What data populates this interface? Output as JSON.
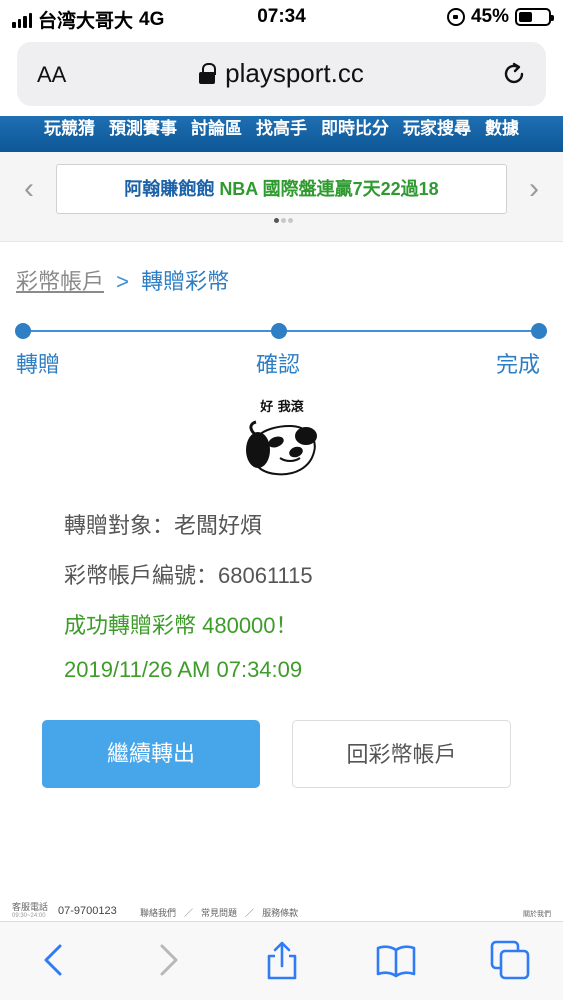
{
  "status_bar": {
    "carrier": "台湾大哥大",
    "network": "4G",
    "time": "07:34",
    "battery": "45%",
    "battery_level": 0.45
  },
  "browser": {
    "text_size_label": "AA",
    "url": "playsport.cc"
  },
  "site_nav": {
    "items": [
      "玩競猜",
      "預測賽事",
      "討論區",
      "找高手",
      "即時比分",
      "玩家搜尋",
      "數據"
    ]
  },
  "banner": {
    "promo_part1": "阿翰賺飽飽",
    "promo_part2": "NBA 國際盤連贏7天22過18"
  },
  "breadcrumb": {
    "parent": "彩幣帳戶",
    "separator": ">",
    "current": "轉贈彩幣"
  },
  "steps": [
    "轉贈",
    "確認",
    "完成"
  ],
  "meme": {
    "caption": "好 我滾"
  },
  "result": {
    "recipient_label": "轉贈對象：",
    "recipient_name": "老闆好煩",
    "account_label": "彩幣帳戶編號：",
    "account_number": "68061115",
    "success_message": "成功轉贈彩幣 480000！",
    "timestamp": "2019/11/26 AM 07:34:09"
  },
  "buttons": {
    "continue": "繼續轉出",
    "back_to_account": "回彩幣帳戶"
  },
  "footer": {
    "service_label": "客服電話",
    "service_hours": "09:30~24:00",
    "phone": "07-9700123",
    "links": [
      "聯絡我們",
      "常見問題",
      "服務條款"
    ],
    "about": "關於我們"
  },
  "colors": {
    "nav_blue": "#1366aa",
    "accent_blue": "#2d7ec5",
    "button_blue": "#47a5ea",
    "success_green": "#3e9c2a"
  }
}
